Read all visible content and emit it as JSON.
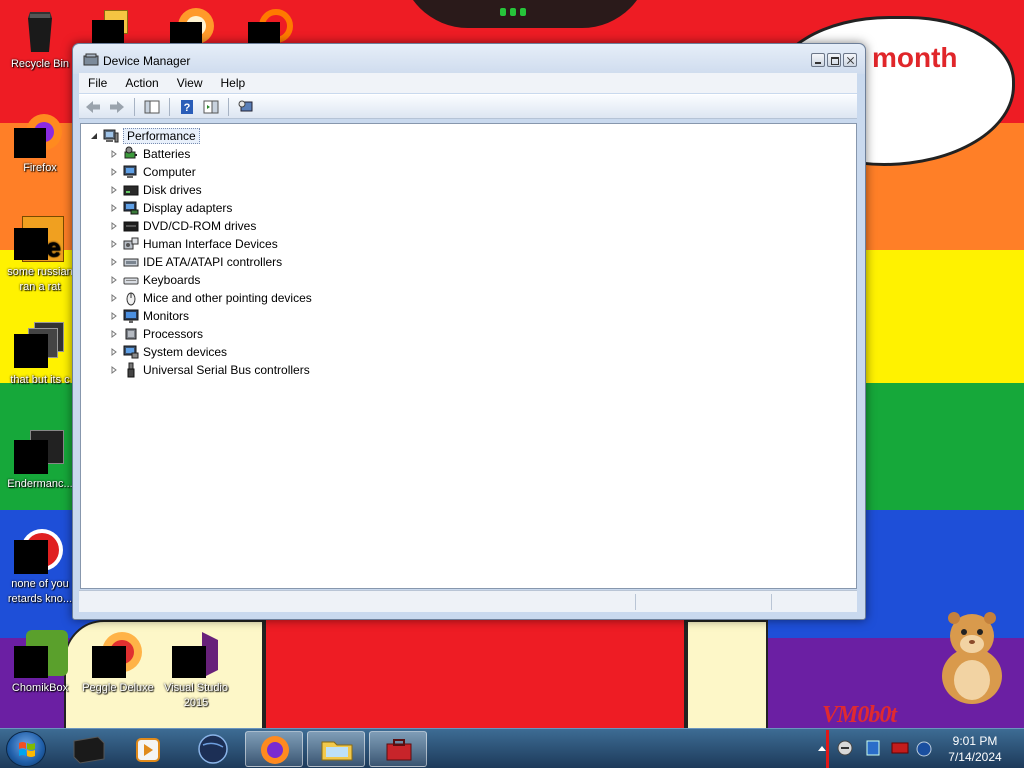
{
  "desktop": {
    "wallpaper_text": "month",
    "watermark": "VM0b0t",
    "icons": [
      {
        "id": "recycle-bin",
        "label": "Recycle Bin"
      },
      {
        "id": "firefox",
        "label": "Firefox"
      },
      {
        "id": "some-russian",
        "label": "some russian ran a rat"
      },
      {
        "id": "that-but-its",
        "label": "that but its c"
      },
      {
        "id": "endermanch",
        "label": "Endermanc..."
      },
      {
        "id": "none-of-you",
        "label": "none of you retards kno..."
      },
      {
        "id": "chomikbox",
        "label": "ChomikBox"
      },
      {
        "id": "peggle",
        "label": "Peggle Deluxe"
      },
      {
        "id": "visual-studio",
        "label": "Visual Studio 2015"
      }
    ]
  },
  "window": {
    "title": "Device Manager",
    "menu": [
      "File",
      "Action",
      "View",
      "Help"
    ],
    "tree": {
      "root": "Performance",
      "items": [
        {
          "label": "Batteries",
          "icon": "battery-icon"
        },
        {
          "label": "Computer",
          "icon": "computer-icon"
        },
        {
          "label": "Disk drives",
          "icon": "disk-drive-icon"
        },
        {
          "label": "Display adapters",
          "icon": "display-adapter-icon"
        },
        {
          "label": "DVD/CD-ROM drives",
          "icon": "dvd-drive-icon"
        },
        {
          "label": "Human Interface Devices",
          "icon": "hid-icon"
        },
        {
          "label": "IDE ATA/ATAPI controllers",
          "icon": "ide-controller-icon"
        },
        {
          "label": "Keyboards",
          "icon": "keyboard-icon"
        },
        {
          "label": "Mice and other pointing devices",
          "icon": "mouse-icon"
        },
        {
          "label": "Monitors",
          "icon": "monitor-icon"
        },
        {
          "label": "Processors",
          "icon": "processor-icon"
        },
        {
          "label": "System devices",
          "icon": "system-devices-icon"
        },
        {
          "label": "Universal Serial Bus controllers",
          "icon": "usb-icon"
        }
      ]
    }
  },
  "taskbar": {
    "clock_time": "9:01 PM",
    "clock_date": "7/14/2024"
  },
  "colors": {
    "accent_window": "#c9d9ee",
    "taskbar": "#2a5078",
    "wallpaper_red": "#ee1c24"
  }
}
